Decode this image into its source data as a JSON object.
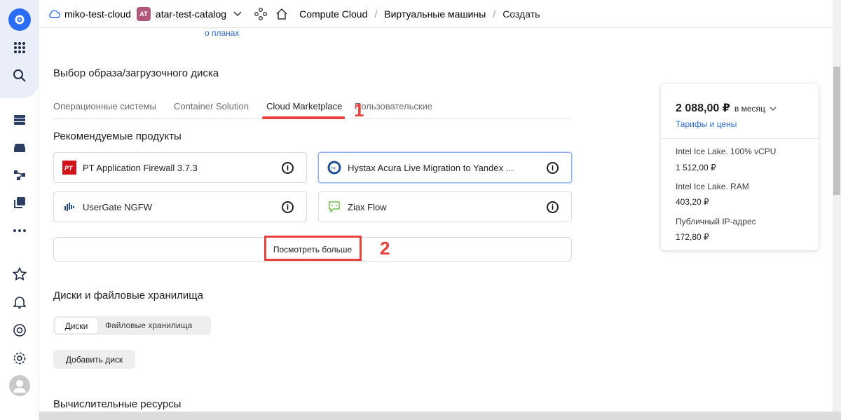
{
  "header": {
    "cloud_name": "miko-test-cloud",
    "catalog_badge": "AT",
    "catalog_name": "atar-test-catalog",
    "breadcrumbs": [
      "Compute Cloud",
      "Виртуальные машины",
      "Создать"
    ]
  },
  "top_link": "о планах",
  "image_section": {
    "title": "Выбор образа/загрузочного диска",
    "tabs": [
      "Операционные системы",
      "Container Solution",
      "Cloud Marketplace",
      "Пользовательские"
    ],
    "active_tab": "Cloud Marketplace",
    "recommended_title": "Рекомендуемые продукты",
    "products": [
      {
        "name": "PT Application Firewall 3.7.3",
        "icon": "pt-logo-icon"
      },
      {
        "name": "Hystax Acura Live Migration to Yandex ...",
        "icon": "hystax-logo-icon"
      },
      {
        "name": "UserGate NGFW",
        "icon": "usergate-logo-icon"
      },
      {
        "name": "Ziax Flow",
        "icon": "ziax-logo-icon"
      }
    ],
    "more_button": "Посмотреть больше"
  },
  "disks_section": {
    "title": "Диски и файловые хранилища",
    "segments": [
      "Диски",
      "Файловые хранилища"
    ],
    "add_button": "Добавить диск"
  },
  "compute_section": {
    "title": "Вычислительные ресурсы"
  },
  "price_panel": {
    "total": "2 088,00 ₽",
    "period": "в месяц",
    "tariffs_link": "Тарифы и цены",
    "lines": [
      {
        "label": "Intel Ice Lake. 100% vCPU",
        "value": "1 512,00 ₽"
      },
      {
        "label": "Intel Ice Lake. RAM",
        "value": "403,20 ₽"
      },
      {
        "label": "Публичный IP-адрес",
        "value": "172,80 ₽"
      }
    ]
  },
  "annotations": [
    "1",
    "2"
  ],
  "colors": {
    "accent": "#2b6cf6",
    "link": "#2f6ccf",
    "annotation": "#e8403a",
    "badge": "#b2577c"
  }
}
